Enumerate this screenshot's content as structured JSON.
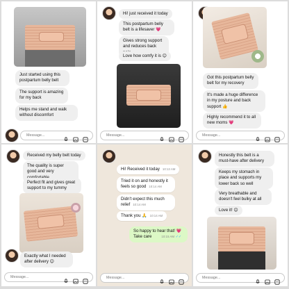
{
  "panels": [
    {
      "id": "p1",
      "messages": [
        {
          "text": "Just started using this postpartum belly belt"
        },
        {
          "text": "The support is amazing for my back"
        },
        {
          "text": "Helps me stand and walk without discomfort"
        }
      ],
      "input_placeholder": "Message..."
    },
    {
      "id": "p2",
      "messages": [
        {
          "text": "Hi! just received it today",
          "emoji": ""
        },
        {
          "text": "This postpartum belly belt is a lifesaver",
          "emoji": "💗"
        },
        {
          "text": "Gives strong support and reduces back pain"
        },
        {
          "text": "Love how comfy it is",
          "emoji": "😊"
        }
      ],
      "input_placeholder": "Message..."
    },
    {
      "id": "p3",
      "messages": [
        {
          "text": "Got this postpartum belly belt for my recovery"
        },
        {
          "text": "It's made a huge difference in my posture and back support",
          "emoji": "👍"
        },
        {
          "text": "Highly recommend it to all new moms",
          "emoji": "💗"
        }
      ],
      "input_placeholder": "Message..."
    },
    {
      "id": "p4",
      "messages": [
        {
          "text": "Received my belly belt today"
        },
        {
          "text": "The quality is super good and very comfortable"
        },
        {
          "text": "Perfect fit and gives great support to my tummy"
        },
        {
          "text": "Exactly what I needed after delivery",
          "emoji": "😊"
        }
      ],
      "input_placeholder": "Message..."
    },
    {
      "id": "p5",
      "messages": [
        {
          "text": "Hi! Received it today",
          "time": "10:13 AM"
        },
        {
          "text": "Tried it on and honestly it feels so good",
          "time": "10:14 AM"
        },
        {
          "text": "Didn't expect this much relief",
          "time": "10:14 AM"
        },
        {
          "text": "Thank you",
          "emoji": "🙏",
          "time": "10:14 AM"
        },
        {
          "text": "So happy to hear that!",
          "emoji": "💗",
          "text2": "Take care",
          "time": "10:15 AM",
          "ticks": "✓✓"
        }
      ],
      "input_placeholder": "Message..."
    },
    {
      "id": "p6",
      "messages": [
        {
          "text": "Honestly this belt is a must-have after delivery"
        },
        {
          "text": "Keeps my stomach in place and supports my lower back so well"
        },
        {
          "text": "Very breathable and doesn't feel bulky at all"
        },
        {
          "text": "Love it!",
          "emoji": "😊"
        }
      ],
      "input_placeholder": "Message..."
    }
  ],
  "icons": {
    "mic": "mic-icon",
    "gallery": "gallery-icon",
    "sticker": "sticker-icon"
  },
  "colors": {
    "incoming_bubble": "#efefef",
    "outgoing_bubble": "#dcf8c6",
    "wa_background": "#efe7dc",
    "heart": "#e8408a",
    "tick": "#34b7f1"
  }
}
